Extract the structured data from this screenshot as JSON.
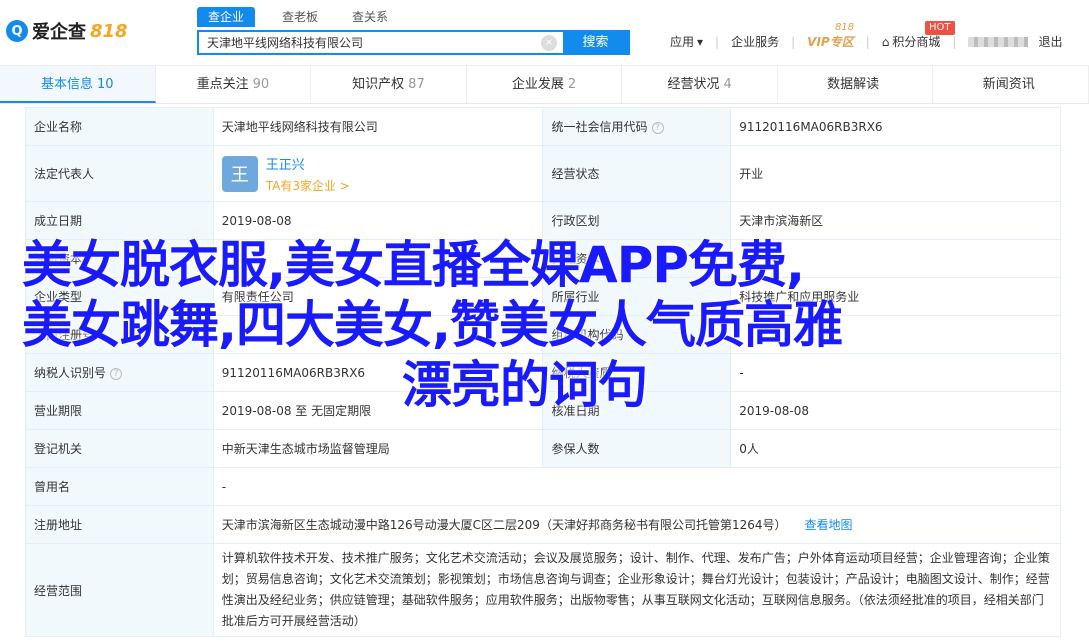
{
  "header": {
    "logo_mark": "Q",
    "logo_text": "爱企查",
    "logo_num": "818",
    "search_tabs": [
      "查企业",
      "查老板",
      "查关系"
    ],
    "search_value": "天津地平线网络科技有限公司",
    "clear_icon": "×",
    "search_button": "搜索",
    "nav": {
      "app": "应用",
      "service": "企业服务",
      "vip": "VIP专区",
      "vip_badge": "818",
      "points": "积分商城",
      "hot": "HOT",
      "logout": "退出"
    }
  },
  "tabs": [
    {
      "label": "基本信息",
      "count": "10"
    },
    {
      "label": "重点关注",
      "count": "90"
    },
    {
      "label": "知识产权",
      "count": "87"
    },
    {
      "label": "企业发展",
      "count": "2"
    },
    {
      "label": "经营状况",
      "count": "4"
    },
    {
      "label": "数据解读",
      "count": ""
    },
    {
      "label": "新闻资讯",
      "count": ""
    }
  ],
  "info": {
    "company_name_label": "企业名称",
    "company_name": "天津地平线网络科技有限公司",
    "credit_code_label": "统一社会信用代码",
    "credit_code": "91120116MA06RB3RX6",
    "legal_rep_label": "法定代表人",
    "legal_rep_avatar": "王",
    "legal_rep_name": "王正兴",
    "legal_rep_link": "TA有3家企业 >",
    "status_label": "经营状态",
    "status": "开业",
    "founded_label": "成立日期",
    "founded": "2019-08-08",
    "region_label": "行政区划",
    "region": "天津市滨海新区",
    "capital_label": "注册资本",
    "capital": "",
    "paidin_label": "实缴资本",
    "paidin": "",
    "type_label": "企业类型",
    "type": "有限责任公司",
    "industry_label": "所属行业",
    "industry": "科技推广和应用服务业",
    "reg_no_label": "工商注册号",
    "reg_no": "",
    "org_code_label": "组织机构代码",
    "org_code": "",
    "taxpayer_label": "纳税人识别号",
    "taxpayer": "91120116MA06RB3RX6",
    "taxpayer_qual_label": "纳税人资质",
    "taxpayer_qual": "-",
    "term_label": "营业期限",
    "term": "2019-08-08 至 无固定期限",
    "approved_label": "核准日期",
    "approved": "2019-08-08",
    "authority_label": "登记机关",
    "authority": "中新天津生态城市场监督管理局",
    "insured_label": "参保人数",
    "insured": "0人",
    "former_label": "曾用名",
    "former": "-",
    "address_label": "注册地址",
    "address": "天津市滨海新区生态城动漫中路126号动漫大厦C区二层209（天津好邦商务秘书有限公司托管第1264号）",
    "map_link": "查看地图",
    "scope_label": "经营范围",
    "scope": "计算机软件技术开发、技术推广服务；文化艺术交流活动；会议及展览服务；设计、制作、代理、发布广告；户外体育运动项目经营；企业管理咨询；企业策划；贸易信息咨询；文化艺术交流策划；影视策划；市场信息咨询与调查；企业形象设计；舞台灯光设计；包装设计；产品设计；电脑图文设计、制作；经营性演出及经纪业务；供应链管理；基础软件服务；应用软件服务；出版物零售；从事互联网文化活动；互联网信息服务。（依法须经批准的项目，经相关部门批准后方可开展经营活动）"
  },
  "overlay": {
    "line1": "美女脱衣服,美女直播全婐APP免费,",
    "line2": "美女跳舞,四大美女,赞美女人气质高雅",
    "line3": "漂亮的词句"
  }
}
